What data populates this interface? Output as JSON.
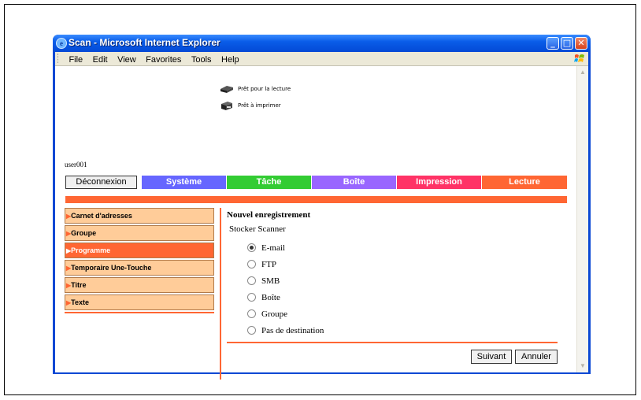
{
  "window": {
    "title": "Scan - Microsoft Internet Explorer",
    "controls": {
      "minimize": "_",
      "maximize": "□",
      "close": "✕"
    }
  },
  "menubar": {
    "items": [
      "File",
      "Edit",
      "View",
      "Favorites",
      "Tools",
      "Help"
    ]
  },
  "status": {
    "ready_read": "Prêt pour la lecture",
    "ready_print": "Prêt à imprimer"
  },
  "user": {
    "name": "user001"
  },
  "toolbar": {
    "logout_label": "Déconnexion"
  },
  "tabs": [
    {
      "label": "Système",
      "color": "#6666ff"
    },
    {
      "label": "Tâche",
      "color": "#33cc33"
    },
    {
      "label": "Boîte",
      "color": "#9966ff"
    },
    {
      "label": "Impression",
      "color": "#ff3366"
    },
    {
      "label": "Lecture",
      "color": "#ff6633"
    }
  ],
  "sidebar": {
    "items": [
      {
        "label": "Carnet d'adresses",
        "active": false
      },
      {
        "label": "Groupe",
        "active": false
      },
      {
        "label": "Programme",
        "active": true
      },
      {
        "label": "Temporaire Une-Touche",
        "active": false
      },
      {
        "label": "Titre",
        "active": false
      },
      {
        "label": "Texte",
        "active": false
      }
    ]
  },
  "main": {
    "heading": "Nouvel enregistrement",
    "subheading": "Stocker Scanner",
    "options": [
      {
        "label": "E-mail",
        "checked": true
      },
      {
        "label": "FTP",
        "checked": false
      },
      {
        "label": "SMB",
        "checked": false
      },
      {
        "label": "Boîte",
        "checked": false
      },
      {
        "label": "Groupe",
        "checked": false
      },
      {
        "label": "Pas de destination",
        "checked": false
      }
    ],
    "next_label": "Suivant",
    "cancel_label": "Annuler"
  },
  "colors": {
    "accent": "#ff6633",
    "nav_bg": "#ffcc99",
    "titlebar": "#0a5de8"
  }
}
